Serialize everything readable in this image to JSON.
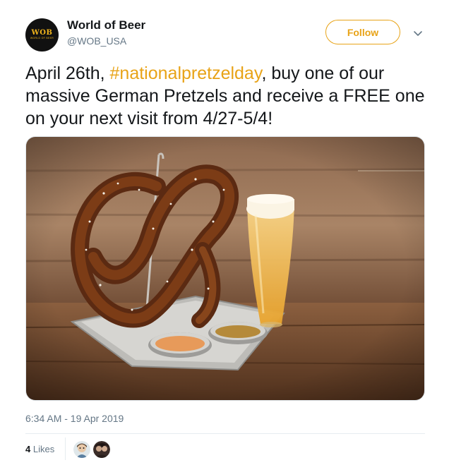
{
  "account": {
    "display_name": "World of Beer",
    "handle": "@WOB_USA",
    "logo_text": "WOB",
    "logo_subtext": "WORLD OF BEER"
  },
  "follow_label": "Follow",
  "tweet": {
    "text_before": "April 26th, ",
    "hashtag": "#nationalpretzelday",
    "text_after": ", buy one of our massive German Pretzels and receive a FREE one on your next visit from 4/27-5/4!"
  },
  "timestamp": "6:34 AM - 19 Apr 2019",
  "likes": {
    "count": "4",
    "label": "Likes"
  },
  "colors": {
    "accent": "#e8a317",
    "text": "#14171a",
    "secondary": "#657786"
  },
  "icons": {
    "caret": "chevron-down-icon"
  }
}
